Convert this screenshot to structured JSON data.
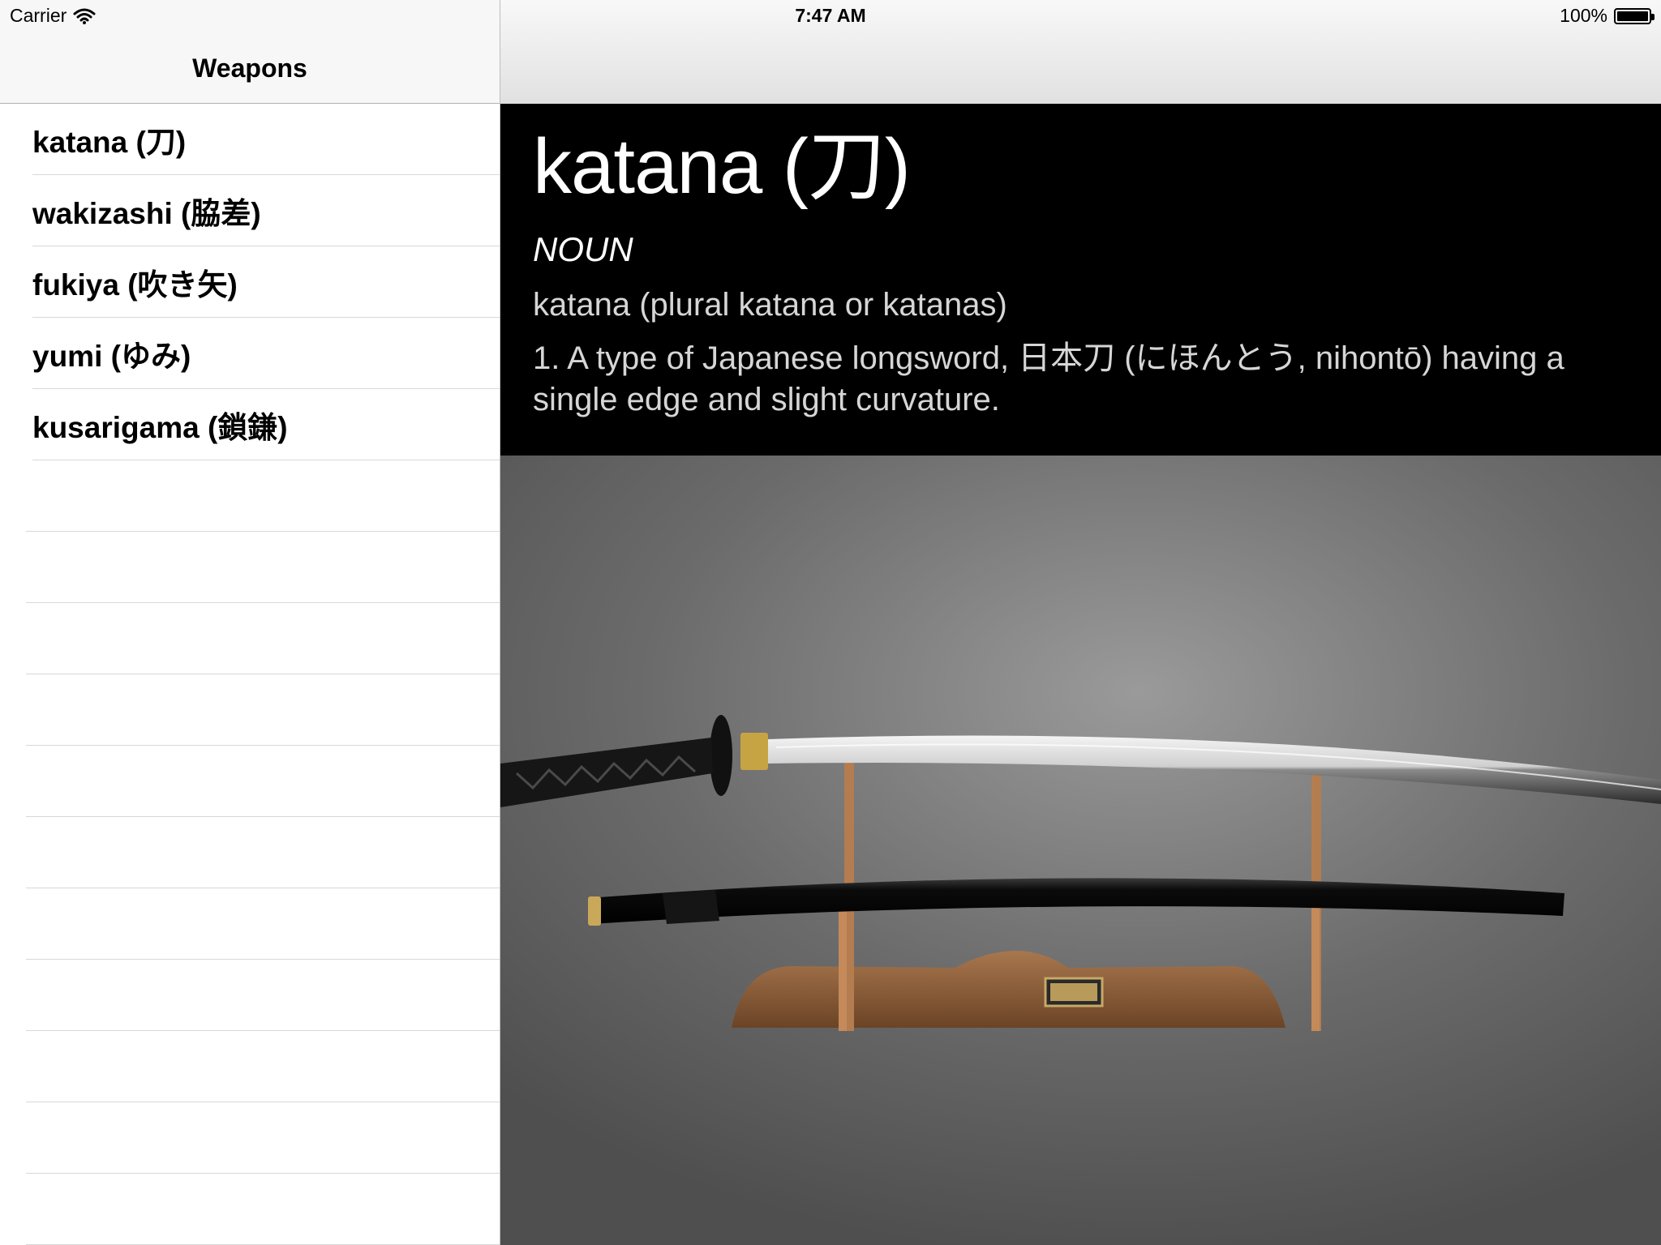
{
  "status_bar": {
    "carrier": "Carrier",
    "time": "7:47 AM",
    "battery": "100%"
  },
  "master": {
    "title": "Weapons",
    "items": [
      {
        "label": "katana (刀)"
      },
      {
        "label": "wakizashi (脇差)"
      },
      {
        "label": "fukiya (吹き矢)"
      },
      {
        "label": "yumi (ゆみ)"
      },
      {
        "label": "kusarigama (鎖鎌)"
      }
    ],
    "selected_index": 0
  },
  "detail": {
    "term": "katana (刀)",
    "part_of_speech": "NOUN",
    "plural": "katana (plural katana or katanas)",
    "definition": "1. A type of Japanese longsword, 日本刀 (にほんとう, nihontō) having a single edge and slight curvature.",
    "image_icon": "katana-on-stand-photo"
  },
  "colors": {
    "definition_background": "#000000",
    "navbar_background": "#f7f7f7",
    "separator": "#d8d8d8"
  }
}
